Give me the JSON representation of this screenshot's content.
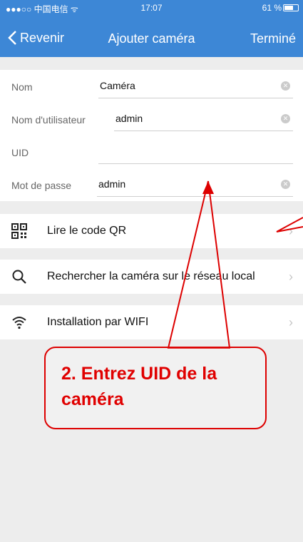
{
  "status_bar": {
    "carrier": "●●●○○ 中国电信 ᯤ",
    "time": "17:07",
    "battery": "61 %"
  },
  "nav": {
    "back_label": "Revenir",
    "title": "Ajouter caméra",
    "done_label": "Terminé"
  },
  "form": {
    "name_label": "Nom",
    "name_value": "Caméra",
    "user_label": "Nom d'utilisateur",
    "user_value": "admin",
    "uid_label": "UID",
    "uid_value": "",
    "password_label": "Mot de passe",
    "password_value": "admin"
  },
  "menu": {
    "qr": "Lire le code QR",
    "search": "Rechercher la caméra sur le réseau local",
    "wifi": "Installation par WIFI"
  },
  "annotation": {
    "text": "2. Entrez UID de la caméra",
    "color": "#e00000"
  },
  "colors": {
    "accent": "#3d87d6",
    "background": "#ededed"
  }
}
